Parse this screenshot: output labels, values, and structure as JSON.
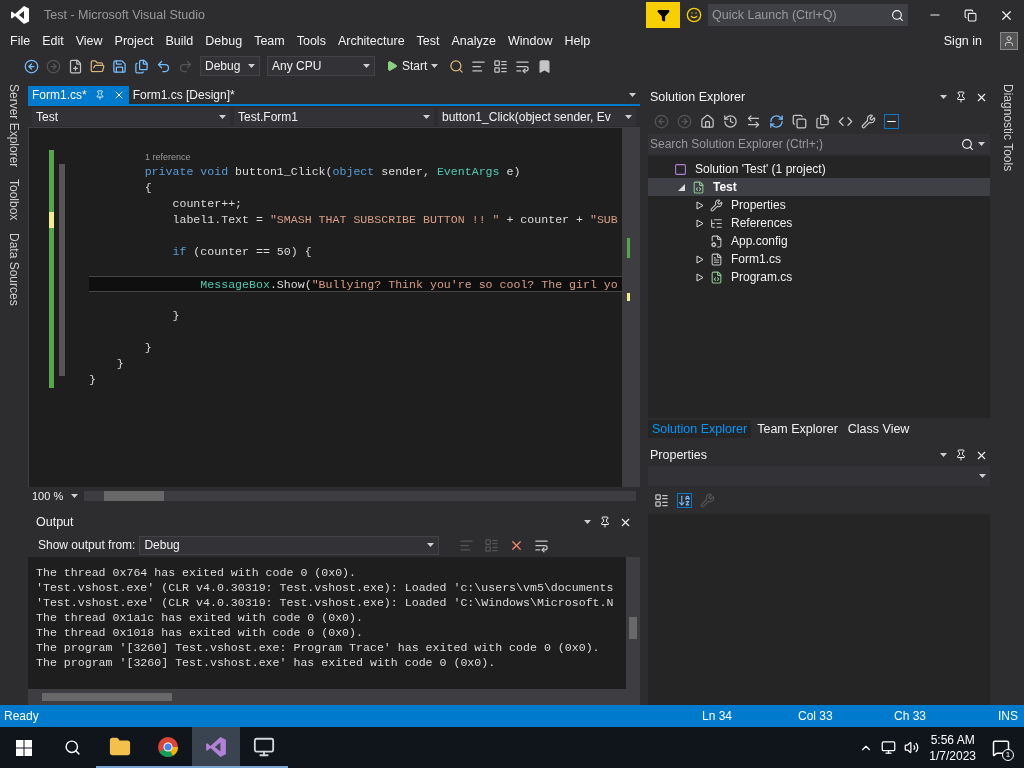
{
  "window": {
    "title": "Test - Microsoft Visual Studio"
  },
  "quick_launch": {
    "placeholder": "Quick Launch (Ctrl+Q)"
  },
  "menu": [
    "File",
    "Edit",
    "View",
    "Project",
    "Build",
    "Debug",
    "Team",
    "Tools",
    "Architecture",
    "Test",
    "Analyze",
    "Window",
    "Help"
  ],
  "account": {
    "label": "Sign in"
  },
  "toolbar": {
    "configuration": "Debug",
    "platform": "Any CPU",
    "start": "Start"
  },
  "left_strip": [
    "Server Explorer",
    "Toolbox",
    "Data Sources"
  ],
  "right_strip": [
    "Diagnostic Tools"
  ],
  "editor": {
    "tabs": [
      {
        "label": "Form1.cs*",
        "selected": true
      },
      {
        "label": "Form1.cs [Design]*",
        "selected": false
      }
    ],
    "nav": [
      "Test",
      "Test.Form1",
      "button1_Click(object sender, Ev"
    ],
    "lines": [
      {
        "selected": false,
        "unsaved": false,
        "codelens": "1 reference",
        "tokens": [
          {
            "kind": "keyword",
            "text": "        private void "
          },
          {
            "kind": "plain",
            "text": "button1_Click("
          },
          {
            "kind": "keyword",
            "text": "object"
          },
          {
            "kind": "plain",
            "text": " sender, "
          },
          {
            "kind": "type",
            "text": "EventArgs"
          },
          {
            "kind": "plain",
            "text": " e)"
          }
        ]
      },
      {
        "selected": false,
        "unsaved": false,
        "tokens": [
          {
            "kind": "plain",
            "text": "        {"
          }
        ]
      },
      {
        "selected": false,
        "unsaved": false,
        "tokens": [
          {
            "kind": "plain",
            "text": "            counter++;"
          }
        ]
      },
      {
        "selected": false,
        "unsaved": true,
        "tokens": [
          {
            "kind": "plain",
            "text": "            label1.Text = "
          },
          {
            "kind": "string",
            "text": "\"SMASH THAT SUBSCRIBE BUTTON !! \""
          },
          {
            "kind": "plain",
            "text": " + counter + "
          },
          {
            "kind": "string",
            "text": "\"SUB"
          }
        ]
      },
      {
        "unsaved": false
      },
      {
        "selected": false,
        "unsaved": false,
        "tokens": [
          {
            "kind": "keyword",
            "text": "            if"
          },
          {
            "kind": "plain",
            "text": " (counter == 50) {"
          }
        ]
      },
      {
        "unsaved": false
      },
      {
        "selected": true,
        "unsaved": false,
        "tokens": [
          {
            "kind": "type",
            "text": "                MessageBox"
          },
          {
            "kind": "plain",
            "text": ".Show("
          },
          {
            "kind": "string",
            "text": "\"Bullying? Think you're so cool? The girl yo"
          }
        ]
      },
      {
        "unsaved": false
      },
      {
        "selected": false,
        "unsaved": false,
        "tokens": [
          {
            "kind": "plain",
            "text": "            }"
          }
        ]
      },
      {
        "unsaved": false
      },
      {
        "selected": false,
        "unsaved": false,
        "tokens": [
          {
            "kind": "plain",
            "text": "        }"
          }
        ]
      },
      {
        "selected": false,
        "unsaved": false,
        "tokens": [
          {
            "kind": "plain",
            "text": "    }"
          }
        ]
      },
      {
        "selected": false,
        "unsaved": false,
        "tokens": [
          {
            "kind": "plain",
            "text": "}"
          }
        ]
      }
    ],
    "zoom": "100 %"
  },
  "output": {
    "title": "Output",
    "source_label": "Show output from:",
    "source": "Debug",
    "lines": [
      "The thread 0x764 has exited with code 0 (0x0).",
      "'Test.vshost.exe' (CLR v4.0.30319: Test.vshost.exe): Loaded 'c:\\users\\vm5\\documents",
      "'Test.vshost.exe' (CLR v4.0.30319: Test.vshost.exe): Loaded 'C:\\Windows\\Microsoft.N",
      "The thread 0x1a1c has exited with code 0 (0x0).",
      "The thread 0x1018 has exited with code 0 (0x0).",
      "The program '[3260] Test.vshost.exe: Program Trace' has exited with code 0 (0x0).",
      "The program '[3260] Test.vshost.exe' has exited with code 0 (0x0)."
    ]
  },
  "solution_explorer": {
    "title": "Solution Explorer",
    "search_placeholder": "Search Solution Explorer (Ctrl+;)",
    "tree": [
      {
        "label": "Solution 'Test' (1 project)",
        "kind": "solution",
        "selected": false,
        "children": [
          {
            "label": "Test",
            "kind": "project",
            "selected": true,
            "expanded": true,
            "children": [
              {
                "label": "Properties",
                "kind": "properties",
                "selected": false,
                "expanded": false
              },
              {
                "label": "References",
                "kind": "references",
                "selected": false,
                "expanded": false
              },
              {
                "label": "App.config",
                "kind": "config",
                "selected": false
              },
              {
                "label": "Form1.cs",
                "kind": "form",
                "selected": false,
                "expanded": false
              },
              {
                "label": "Program.cs",
                "kind": "csharp",
                "selected": false,
                "expanded": false
              }
            ]
          }
        ]
      }
    ],
    "tabs": [
      {
        "label": "Solution Explorer",
        "selected": true
      },
      {
        "label": "Team Explorer",
        "selected": false
      },
      {
        "label": "Class View",
        "selected": false
      }
    ]
  },
  "properties": {
    "title": "Properties"
  },
  "status_bar": {
    "message": "Ready",
    "line": "Ln 34",
    "column": "Col 33",
    "char": "Ch 33",
    "mode": "INS"
  },
  "taskbar": {
    "apps": [
      {
        "kind": "explorer",
        "selected": false
      },
      {
        "kind": "chrome",
        "selected": false
      },
      {
        "kind": "visual-studio",
        "selected": true
      },
      {
        "kind": "monitor",
        "selected": false
      }
    ],
    "time": "5:56 AM",
    "date": "1/7/2023",
    "notifications": "1"
  }
}
